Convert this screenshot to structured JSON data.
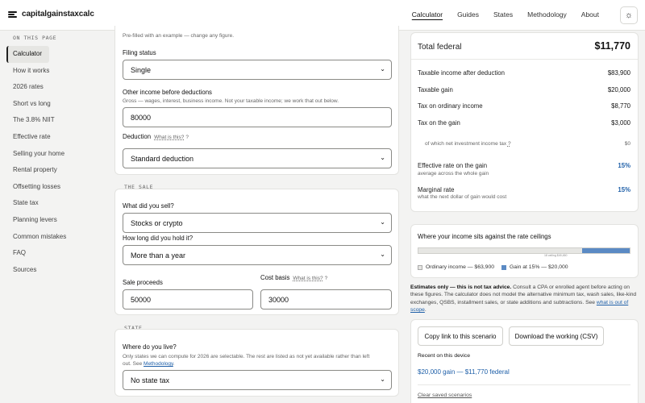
{
  "header": {
    "brand": "capitalgainstaxcalc",
    "nav": [
      "Calculator",
      "Guides",
      "States",
      "Methodology",
      "About"
    ],
    "theme_icon": "sun-icon"
  },
  "sidebar": {
    "heading": "ON THIS PAGE",
    "items": [
      "Calculator",
      "How it works",
      "2026 rates",
      "Short vs long",
      "The 3.8% NIIT",
      "Effective rate",
      "Selling your home",
      "Rental property",
      "Offsetting losses",
      "State tax",
      "Planning levers",
      "Common mistakes",
      "FAQ",
      "Sources"
    ]
  },
  "form": {
    "intro": "Pre-filled with an example — change any figure.",
    "filing_status_label": "Filing status",
    "filing_status_value": "Single",
    "other_income_label": "Other income before deductions",
    "other_income_hint": "Gross — wages, interest, business income. Not your taxable income; we work that out below.",
    "other_income_value": "80000",
    "deduction_label": "Deduction",
    "deduction_help": "What is this?",
    "deduction_value": "Standard deduction",
    "sale_tag": "THE SALE",
    "sold_label": "What did you sell?",
    "sold_value": "Stocks or crypto",
    "held_label": "How long did you hold it?",
    "held_value": "More than a year",
    "proceeds_label": "Sale proceeds",
    "proceeds_value": "50000",
    "basis_label": "Cost basis",
    "basis_help": "What is this?",
    "basis_value": "30000",
    "state_tag": "STATE",
    "state_label": "Where do you live?",
    "state_hint_1": "Only states we can compute for 2026 are selectable. The rest are listed as not yet available rather than left",
    "state_hint_2": "out. See",
    "state_hint_link": "Methodology",
    "state_value": "No state tax"
  },
  "results": {
    "total_label": "Total federal",
    "total_value": "$11,770",
    "rows": [
      {
        "label": "Taxable income after deduction",
        "value": "$83,900"
      },
      {
        "label": "Taxable gain",
        "value": "$20,000"
      },
      {
        "label": "Tax on ordinary income",
        "value": "$8,770"
      },
      {
        "label": "Tax on the gain",
        "value": "$3,000"
      }
    ],
    "niit_label": "of which net investment income tax",
    "niit_help": "?",
    "niit_value": "$0",
    "effective_label": "Effective rate on the gain",
    "effective_sub": "average across the whole gain",
    "effective_value": "15%",
    "marginal_label": "Marginal rate",
    "marginal_sub": "what the next dollar of gain would cost",
    "marginal_value": "15%"
  },
  "ceilings": {
    "title": "Where your income sits against the rate ceilings",
    "ordinary_fraction": 0.7765,
    "marker_label": "18 ceiling $49,450",
    "legend_ordinary": "Ordinary income — $63,900",
    "legend_gain": "Gain at 15% — $20,000",
    "ordinary_color": "#e6e6e3",
    "gain_color": "#5b8ac4"
  },
  "disclaimer": {
    "bold": "Estimates only — this is not tax advice.",
    "text": " Consult a CPA or enrolled agent before acting on these figures. The calculator does not model the alternative minimum tax, wash sales, like-kind exchanges, QSBS, installment sales, or state additions and subtractions. See ",
    "link": "what is out of scope",
    "end": "."
  },
  "actions": {
    "copy_link": "Copy link to this scenario",
    "download": "Download the working (CSV)",
    "recent_heading": "Recent on this device",
    "recent_item": "$20,000 gain — $11,770 federal",
    "clear": "Clear saved scenarios"
  }
}
